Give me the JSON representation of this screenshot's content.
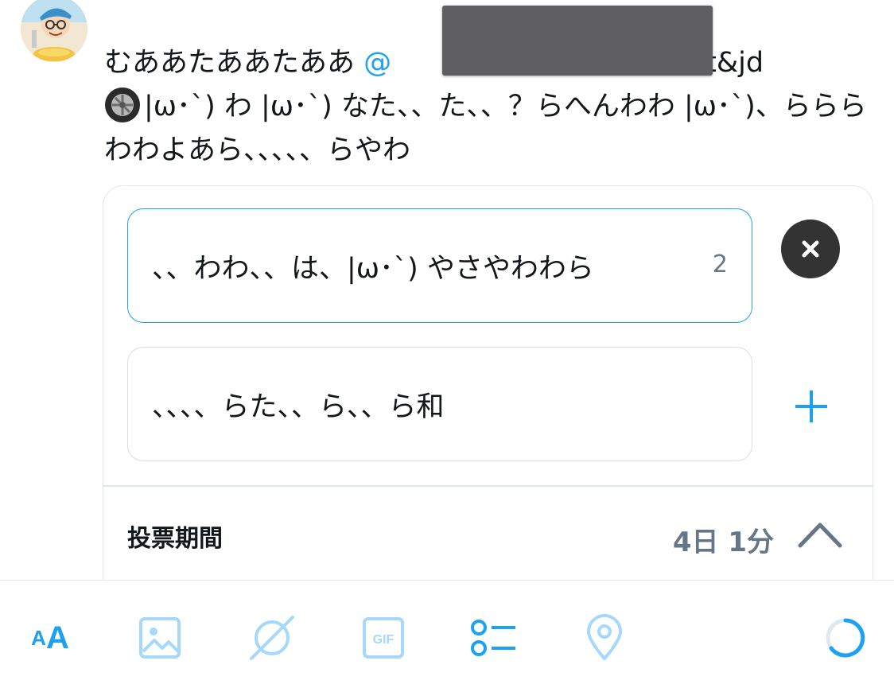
{
  "tweet": {
    "text_part1": "むああたああたああ ",
    "mention": "@",
    "text_part2": "。t&jd",
    "text_part3": "|ω･`) わ |ω･`) なた、、た、、？らへんわわ |ω･`)、らららわわよあら、、、、、らやわ"
  },
  "poll": {
    "choices": [
      {
        "value": "、、わわ、、は、|ω･`) やさやわわら",
        "counter": "2"
      },
      {
        "value": "、、、、らた、、ら、、ら和"
      }
    ],
    "length_label": "投票期間",
    "length_value": "4日 1分"
  },
  "toolbar": {
    "text_size_small": "A",
    "text_size_large": "A",
    "items": [
      "text-size",
      "image",
      "spark",
      "gif",
      "poll",
      "location"
    ]
  },
  "colors": {
    "accent": "#1da1f2",
    "accent_light": "#a5d8fa",
    "text": "#14171a",
    "secondary": "#657786"
  },
  "icons": [
    "wheel-emoji-icon",
    "close-icon",
    "plus-icon",
    "chevron-up-icon",
    "image-icon",
    "spark-icon",
    "gif-icon",
    "poll-icon",
    "location-icon",
    "progress-ring-icon"
  ]
}
